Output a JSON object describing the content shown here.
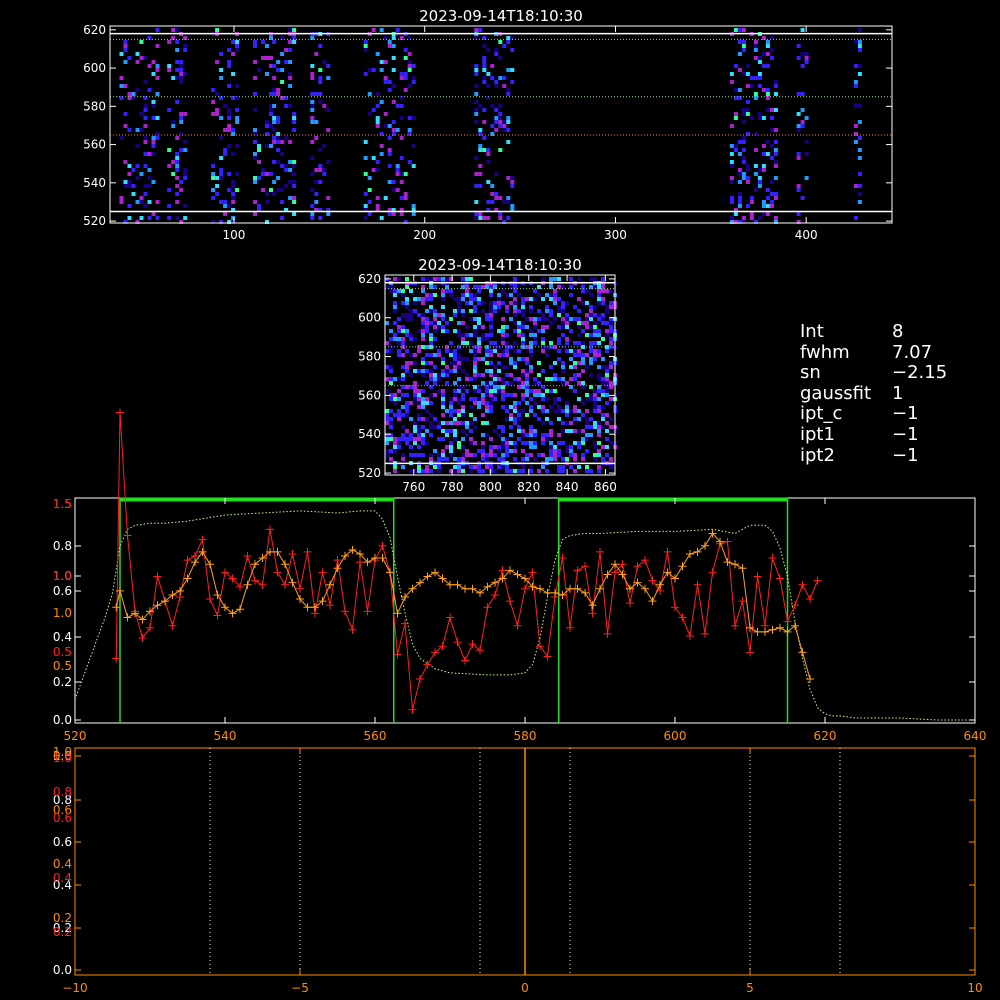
{
  "colors": {
    "background": "#000000",
    "axes": "#ffffff",
    "profile_raw": "#ff2020",
    "profile_smooth": "#ffa020",
    "profile_mean": "#c8ff80",
    "window": "#22dd22",
    "spectrum": "#ff8c00",
    "grid_dotted": "#ffff99",
    "cmap": [
      "#1a0080",
      "#3322ff",
      "#2299ff",
      "#33ddff",
      "#33ff99",
      "#aa22cc"
    ]
  },
  "info_panel": {
    "rows": [
      {
        "label": "Int",
        "value": "8"
      },
      {
        "label": "fwhm",
        "value": "7.07"
      },
      {
        "label": "sn",
        "value": "−2.15"
      },
      {
        "label": "gaussfit",
        "value": "1"
      },
      {
        "label": "ipt_c",
        "value": "−1"
      },
      {
        "label": "ipt1",
        "value": "−1"
      },
      {
        "label": "ipt2",
        "value": "−1"
      }
    ]
  },
  "chart_data": [
    {
      "type": "heatmap",
      "title": "2023-09-14T18:10:30",
      "xlim": [
        35,
        445
      ],
      "ylim": [
        519,
        622
      ],
      "x_ticks": [
        "100",
        "200",
        "300",
        "400"
      ],
      "y_ticks": [
        "520",
        "540",
        "560",
        "580",
        "600",
        "620"
      ],
      "solid_lines_y": [
        525,
        618
      ],
      "dotted_lines_y": [
        565,
        615,
        585
      ],
      "active_bands_x": [
        [
          40,
          60
        ],
        [
          65,
          75
        ],
        [
          88,
          102
        ],
        [
          110,
          120
        ],
        [
          140,
          150
        ],
        [
          120,
          132
        ],
        [
          168,
          195
        ],
        [
          226,
          246
        ],
        [
          360,
          385
        ],
        [
          395,
          400
        ],
        [
          425,
          428
        ]
      ]
    },
    {
      "type": "heatmap",
      "title": "2023-09-14T18:10:30",
      "xlim": [
        745,
        865
      ],
      "ylim": [
        519,
        622
      ],
      "x_ticks": [
        "760",
        "780",
        "800",
        "820",
        "840",
        "860"
      ],
      "y_ticks": [
        "520",
        "540",
        "560",
        "580",
        "600",
        "620"
      ],
      "solid_lines_y": [
        525,
        618
      ],
      "dotted_lines_y": [
        565,
        615,
        585
      ]
    },
    {
      "type": "line",
      "title": "",
      "xlabel": "",
      "ylabel": "",
      "xlim": [
        520,
        640
      ],
      "x_ticks": [
        "520",
        "540",
        "560",
        "580",
        "600",
        "620",
        "640"
      ],
      "y_ticks_white": [
        "0.0",
        "0.2",
        "0.4",
        "0.6",
        "0.8",
        "1.0"
      ],
      "y_ticks_orange": [
        "0.5",
        "1.0",
        "1.5"
      ],
      "y_ticks_red": [
        "0.5",
        "1.0",
        "1.5"
      ],
      "window_edges_x": [
        526,
        562.5,
        584.5,
        615
      ],
      "series": [
        {
          "x": [
            525.5,
            526,
            527,
            528,
            529,
            530,
            531,
            532,
            533,
            534,
            535,
            536,
            537,
            538,
            539,
            540,
            541,
            542,
            543,
            544,
            545,
            546,
            547,
            548,
            549,
            550,
            551,
            552,
            553,
            554,
            555,
            556,
            557,
            558,
            559,
            560,
            561,
            562,
            563,
            564,
            565,
            566,
            567,
            568,
            569,
            570,
            571,
            572,
            573,
            574,
            575,
            576,
            577,
            578,
            579,
            580,
            581,
            582,
            583,
            584,
            585,
            586,
            587,
            588,
            589,
            590,
            591,
            592,
            593,
            594,
            595,
            596,
            597,
            598,
            599,
            600,
            601,
            602,
            603,
            604,
            605,
            606,
            607,
            608,
            609,
            610,
            611,
            612,
            613,
            614,
            615,
            616,
            617,
            618,
            619
          ],
          "y": [
            0.3,
            1.5,
            0.9,
            0.53,
            0.4,
            0.45,
            0.7,
            0.58,
            0.46,
            0.6,
            0.78,
            0.8,
            0.88,
            0.59,
            0.51,
            0.72,
            0.69,
            0.65,
            0.8,
            0.68,
            0.66,
            0.93,
            0.72,
            0.66,
            0.81,
            0.64,
            0.82,
            0.52,
            0.72,
            0.56,
            0.78,
            0.53,
            0.44,
            0.77,
            0.53,
            0.78,
            0.85,
            0.72,
            0.32,
            0.47,
            0.05,
            0.2,
            0.27,
            0.33,
            0.36,
            0.5,
            0.38,
            0.29,
            0.37,
            0.34,
            0.55,
            0.61,
            0.73,
            0.58,
            0.46,
            0.64,
            0.72,
            0.36,
            0.31,
            0.6,
            0.79,
            0.45,
            0.73,
            0.75,
            0.52,
            0.82,
            0.42,
            0.72,
            0.76,
            0.57,
            0.75,
            0.78,
            0.68,
            0.63,
            0.82,
            0.55,
            0.5,
            0.41,
            0.66,
            0.42,
            0.72,
            0.86,
            0.87,
            0.46,
            0.58,
            0.33,
            0.7,
            0.46,
            0.79,
            0.69,
            0.48,
            0.56,
            0.66,
            0.59,
            0.68
          ]
        },
        {
          "x": [
            525.5,
            526,
            527,
            528,
            529,
            530,
            531,
            532,
            533,
            534,
            535,
            536,
            537,
            538,
            539,
            540,
            541,
            542,
            543,
            544,
            545,
            546,
            547,
            548,
            549,
            550,
            551,
            552,
            553,
            554,
            555,
            556,
            557,
            558,
            559,
            560,
            561,
            562,
            563,
            564,
            565,
            566,
            567,
            568,
            569,
            570,
            571,
            572,
            573,
            574,
            575,
            576,
            577,
            578,
            579,
            580,
            581,
            582,
            583,
            584,
            585,
            586,
            587,
            588,
            589,
            590,
            591,
            592,
            593,
            594,
            595,
            596,
            597,
            598,
            599,
            600,
            601,
            602,
            603,
            604,
            605,
            606,
            607,
            608,
            609,
            610,
            611,
            612,
            613,
            614,
            615,
            616,
            617,
            618
          ],
          "y": [
            0.55,
            0.63,
            0.5,
            0.52,
            0.49,
            0.53,
            0.56,
            0.58,
            0.61,
            0.63,
            0.69,
            0.77,
            0.82,
            0.76,
            0.61,
            0.55,
            0.52,
            0.54,
            0.66,
            0.76,
            0.79,
            0.82,
            0.82,
            0.76,
            0.67,
            0.59,
            0.55,
            0.55,
            0.58,
            0.66,
            0.74,
            0.8,
            0.83,
            0.81,
            0.77,
            0.79,
            0.79,
            0.72,
            0.52,
            0.6,
            0.64,
            0.67,
            0.7,
            0.72,
            0.69,
            0.66,
            0.66,
            0.64,
            0.64,
            0.62,
            0.65,
            0.67,
            0.69,
            0.73,
            0.71,
            0.69,
            0.65,
            0.64,
            0.62,
            0.62,
            0.61,
            0.64,
            0.64,
            0.62,
            0.56,
            0.64,
            0.71,
            0.76,
            0.71,
            0.64,
            0.67,
            0.64,
            0.58,
            0.66,
            0.72,
            0.69,
            0.75,
            0.81,
            0.82,
            0.85,
            0.91,
            0.87,
            0.77,
            0.76,
            0.74,
            0.45,
            0.43,
            0.43,
            0.44,
            0.45,
            0.43,
            0.46,
            0.33,
            0.2
          ]
        },
        {
          "x": [
            520,
            522,
            524,
            525,
            526,
            527,
            528,
            530,
            532,
            535,
            540,
            545,
            550,
            555,
            558,
            560,
            561,
            562,
            563,
            564,
            565,
            566,
            568,
            570,
            575,
            578,
            580,
            581,
            582,
            583,
            584,
            585,
            586,
            588,
            590,
            595,
            600,
            605,
            608,
            610,
            612,
            613,
            614,
            615,
            616,
            617,
            618,
            619,
            620,
            621,
            622,
            624,
            630,
            635,
            640
          ],
          "y": [
            0.1,
            0.3,
            0.5,
            0.62,
            0.85,
            0.93,
            0.95,
            0.96,
            0.96,
            0.97,
            1.0,
            1.01,
            1.02,
            1.01,
            1.02,
            1.02,
            0.98,
            0.89,
            0.7,
            0.52,
            0.37,
            0.3,
            0.25,
            0.23,
            0.22,
            0.22,
            0.23,
            0.27,
            0.4,
            0.6,
            0.78,
            0.88,
            0.9,
            0.91,
            0.91,
            0.92,
            0.92,
            0.93,
            0.91,
            0.95,
            0.95,
            0.92,
            0.84,
            0.7,
            0.48,
            0.3,
            0.15,
            0.06,
            0.03,
            0.02,
            0.02,
            0.01,
            0.01,
            0.0,
            0.0
          ]
        }
      ]
    },
    {
      "type": "line",
      "title": "",
      "xlabel": "",
      "ylabel": "",
      "xlim": [
        -10,
        10
      ],
      "x_ticks": [
        "−10",
        "−5",
        "0",
        "5",
        "10"
      ],
      "y_ticks_white": [
        "0.0",
        "0.2",
        "0.4",
        "0.6",
        "0.8",
        "1.0"
      ],
      "y_ticks_orange": [
        "0.2",
        "0.4",
        "0.6",
        "0.8",
        "1.0"
      ],
      "y_ticks_red": [
        "0.2",
        "0.4",
        "0.6",
        "0.8",
        "1.0"
      ],
      "dotted_lines_x": [
        -7,
        -5,
        -1,
        1,
        5,
        7
      ],
      "spike_x": 0
    }
  ]
}
